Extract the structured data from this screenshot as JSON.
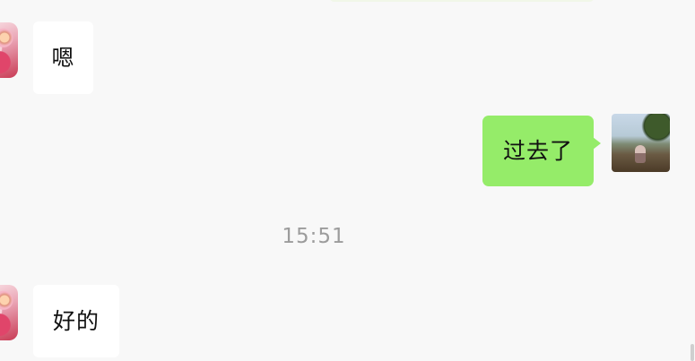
{
  "chat": {
    "messages": [
      {
        "side": "left",
        "text": "嗯"
      },
      {
        "side": "right",
        "text": "过去了"
      },
      {
        "side": "left",
        "text": "好的"
      }
    ],
    "timestamp": "15:51"
  },
  "colors": {
    "background": "#f8f8f8",
    "incoming_bubble": "#ffffff",
    "outgoing_bubble": "#95ec69",
    "timestamp_text": "#9c9c9c"
  },
  "icons": {
    "contact_avatar": "avatar-photo",
    "self_avatar": "avatar-landscape-photo"
  }
}
